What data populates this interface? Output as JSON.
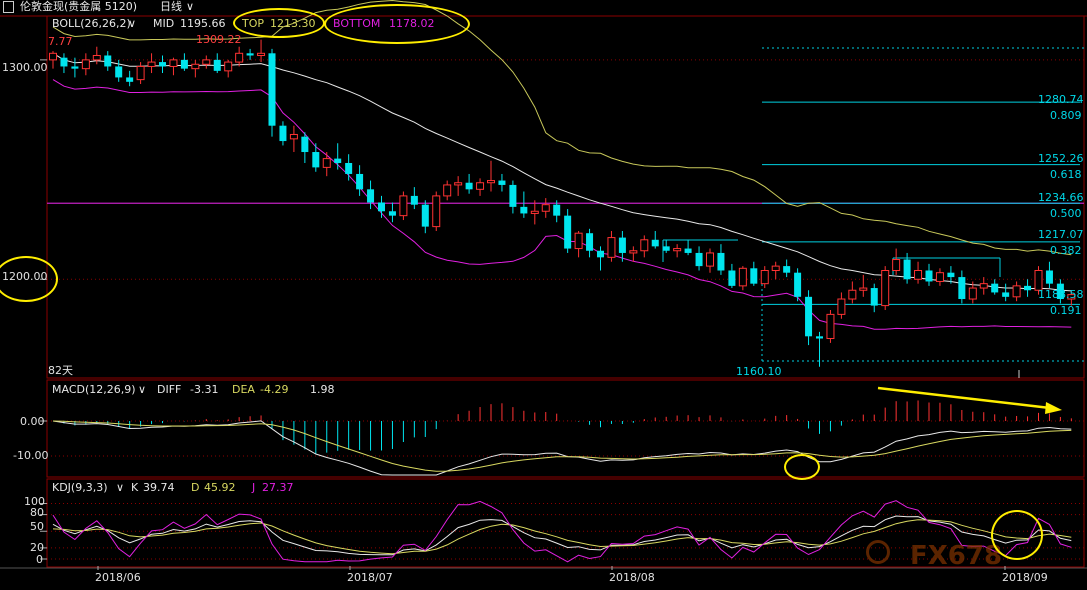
{
  "window": {
    "title": "伦敦金现(贵金属 5120)",
    "period": "日线"
  },
  "boll": {
    "label": "BOLL(26,26,2)",
    "mid_label": "MID",
    "mid_value": "1195.66",
    "top_label": "TOP",
    "top_value": "1213.30",
    "bottom_label": "BOTTOM",
    "bottom_value": "1178.02"
  },
  "macd": {
    "label": "MACD(12,26,9)",
    "diff_label": "DIFF",
    "diff_value": "-3.31",
    "dea_label": "DEA",
    "dea_value": "-4.29",
    "macd_value": "1.98"
  },
  "kdj": {
    "label": "KDJ(9,3,3)",
    "k_label": "K",
    "k_value": "39.74",
    "d_label": "D",
    "d_value": "45.92",
    "j_label": "J",
    "j_value": "27.37"
  },
  "annotations": {
    "high_left": "7.77",
    "high_mark": "1309.22",
    "low_mark": "1160.10",
    "days": "82天"
  },
  "fib_levels": [
    {
      "price": "1280.74",
      "ratio": "0.809"
    },
    {
      "price": "1252.26",
      "ratio": "0.618"
    },
    {
      "price": "1234.66",
      "ratio": "0.500"
    },
    {
      "price": "1217.07",
      "ratio": "0.382"
    },
    {
      "price": "1188.58",
      "ratio": "0.191"
    }
  ],
  "watermark": "FX678",
  "colors": {
    "up": "#ff3333",
    "down": "#00e5ee",
    "grid": "#8b0000",
    "mid": "#e8e8e8",
    "top": "#c8c85a",
    "bottom": "#e020e0",
    "highlight": "#ffee00",
    "fib": "#00d0e0"
  },
  "chart_data": [
    {
      "type": "candlestick",
      "title": "伦敦金现(贵金属 5120) 日线",
      "x_ticks": [
        "2018/06",
        "2018/07",
        "2018/08",
        "2018/09"
      ],
      "y_ticks": [
        "1300.00",
        "1200.00"
      ],
      "ylim": [
        1155,
        1320
      ],
      "candles": [
        [
          1300,
          1304,
          1296,
          1303
        ],
        [
          1301,
          1303,
          1294,
          1297
        ],
        [
          1297,
          1301,
          1292,
          1296
        ],
        [
          1296,
          1303,
          1293,
          1300
        ],
        [
          1300,
          1306,
          1298,
          1302
        ],
        [
          1302,
          1304,
          1295,
          1297
        ],
        [
          1297,
          1300,
          1290,
          1292
        ],
        [
          1292,
          1295,
          1288,
          1290
        ],
        [
          1291,
          1299,
          1289,
          1297
        ],
        [
          1297,
          1303,
          1294,
          1299
        ],
        [
          1299,
          1302,
          1294,
          1297
        ],
        [
          1297,
          1301,
          1293,
          1300
        ],
        [
          1300,
          1303,
          1295,
          1296
        ],
        [
          1296,
          1300,
          1292,
          1298
        ],
        [
          1298,
          1302,
          1296,
          1300
        ],
        [
          1300,
          1303,
          1294,
          1295
        ],
        [
          1295,
          1300,
          1292,
          1299
        ],
        [
          1299,
          1306,
          1297,
          1303
        ],
        [
          1303,
          1305,
          1300,
          1302
        ],
        [
          1302,
          1309.22,
          1299,
          1303
        ],
        [
          1303,
          1305,
          1265,
          1270
        ],
        [
          1270,
          1272,
          1261,
          1263
        ],
        [
          1264,
          1270,
          1258,
          1266
        ],
        [
          1265,
          1267,
          1253,
          1258
        ],
        [
          1258,
          1262,
          1249,
          1251
        ],
        [
          1251,
          1258,
          1247,
          1255
        ],
        [
          1255,
          1262,
          1250,
          1253
        ],
        [
          1253,
          1257,
          1245,
          1248
        ],
        [
          1248,
          1252,
          1238,
          1241
        ],
        [
          1241,
          1245,
          1232,
          1235
        ],
        [
          1235,
          1238,
          1228,
          1231
        ],
        [
          1231,
          1235,
          1226,
          1229
        ],
        [
          1229,
          1240,
          1227,
          1238
        ],
        [
          1238,
          1242,
          1232,
          1234
        ],
        [
          1234,
          1236,
          1221,
          1224
        ],
        [
          1224,
          1240,
          1222,
          1238
        ],
        [
          1238,
          1245,
          1236,
          1243
        ],
        [
          1243,
          1247,
          1238,
          1244
        ],
        [
          1244,
          1248,
          1239,
          1241
        ],
        [
          1241,
          1246,
          1238,
          1244
        ],
        [
          1244,
          1254,
          1240,
          1245
        ],
        [
          1245,
          1248,
          1240,
          1243
        ],
        [
          1243,
          1245,
          1230,
          1233
        ],
        [
          1233,
          1240,
          1228,
          1230
        ],
        [
          1230,
          1236,
          1225,
          1231
        ],
        [
          1231,
          1237,
          1228,
          1234
        ],
        [
          1234,
          1236,
          1226,
          1229
        ],
        [
          1229,
          1232,
          1212,
          1214
        ],
        [
          1214,
          1222,
          1210,
          1221
        ],
        [
          1221,
          1223,
          1210,
          1213
        ],
        [
          1213,
          1215,
          1204,
          1210
        ],
        [
          1210,
          1222,
          1208,
          1219
        ],
        [
          1219,
          1222,
          1208,
          1212
        ],
        [
          1212,
          1215,
          1208,
          1213
        ],
        [
          1213,
          1220,
          1210,
          1218
        ],
        [
          1218,
          1222,
          1214,
          1215
        ],
        [
          1215,
          1218,
          1212,
          1213
        ],
        [
          1213,
          1216,
          1210,
          1214
        ],
        [
          1214,
          1218,
          1211,
          1212
        ],
        [
          1212,
          1215,
          1204,
          1206
        ],
        [
          1206,
          1214,
          1203,
          1212
        ],
        [
          1212,
          1216,
          1202,
          1204
        ],
        [
          1204,
          1207,
          1196,
          1197
        ],
        [
          1197,
          1206,
          1195,
          1205
        ],
        [
          1205,
          1208,
          1197,
          1198
        ],
        [
          1198,
          1206,
          1196,
          1204
        ],
        [
          1204,
          1208,
          1200,
          1206
        ],
        [
          1206,
          1209,
          1201,
          1203
        ],
        [
          1203,
          1205,
          1190,
          1192
        ],
        [
          1192,
          1195,
          1170,
          1174
        ],
        [
          1174,
          1176,
          1160.1,
          1173
        ],
        [
          1173,
          1186,
          1171,
          1184
        ],
        [
          1184,
          1194,
          1182,
          1191
        ],
        [
          1191,
          1199,
          1189,
          1195
        ],
        [
          1195,
          1202,
          1192,
          1196
        ],
        [
          1196,
          1198,
          1185,
          1188
        ],
        [
          1188,
          1206,
          1186,
          1204
        ],
        [
          1204,
          1214,
          1202,
          1209
        ],
        [
          1209,
          1212,
          1198,
          1200
        ],
        [
          1200,
          1208,
          1198,
          1204
        ],
        [
          1204,
          1207,
          1197,
          1199
        ],
        [
          1199,
          1205,
          1197,
          1203
        ],
        [
          1203,
          1206,
          1198,
          1201
        ],
        [
          1201,
          1204,
          1189,
          1191
        ],
        [
          1191,
          1199,
          1189,
          1196
        ],
        [
          1196,
          1201,
          1193,
          1198
        ],
        [
          1198,
          1200,
          1193,
          1194
        ],
        [
          1194,
          1198,
          1190,
          1192
        ],
        [
          1192,
          1199,
          1190,
          1197
        ],
        [
          1197,
          1200,
          1192,
          1195
        ],
        [
          1195,
          1206,
          1193,
          1204
        ],
        [
          1204,
          1208,
          1196,
          1198
        ],
        [
          1198,
          1200,
          1189,
          1191
        ],
        [
          1191,
          1195,
          1188,
          1193
        ]
      ]
    },
    {
      "type": "bar",
      "title": "MACD(12,26,9)",
      "y_ticks": [
        "0.00",
        "-10.00"
      ]
    },
    {
      "type": "line",
      "title": "KDJ(9,3,3)",
      "y_ticks": [
        "100",
        "80",
        "50",
        "20",
        "0"
      ]
    }
  ]
}
